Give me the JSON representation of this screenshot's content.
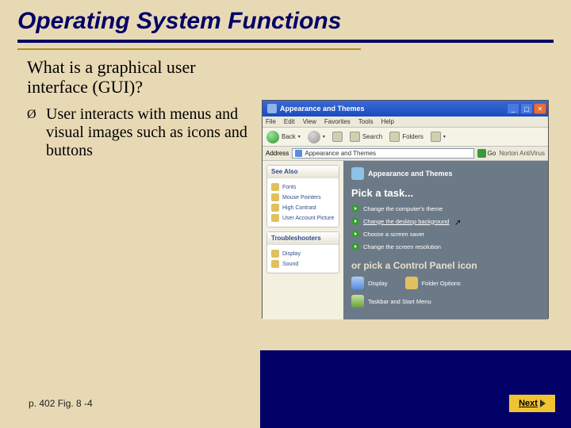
{
  "title": "Operating System Functions",
  "question": "What is a graphical user interface (GUI)?",
  "bullet_mark": "Ø",
  "bullet_text": "User interacts with menus and visual images such as icons and buttons",
  "screenshot": {
    "window_title": "Appearance and Themes",
    "menubar": [
      "File",
      "Edit",
      "View",
      "Favorites",
      "Tools",
      "Help"
    ],
    "toolbar": {
      "back": "Back",
      "search": "Search",
      "folders": "Folders"
    },
    "addrbar": {
      "label": "Address",
      "value": "Appearance and Themes",
      "go": "Go",
      "norton": "Norton AntiVirus"
    },
    "left": {
      "see_also": {
        "heading": "See Also",
        "items": [
          "Fonts",
          "Mouse Pointers",
          "High Contrast",
          "User Account Picture"
        ]
      },
      "troubleshoot": {
        "heading": "Troubleshooters",
        "items": [
          "Display",
          "Sound"
        ]
      }
    },
    "right": {
      "category": "Appearance and Themes",
      "pick_task": "Pick a task...",
      "tasks": [
        "Change the computer's theme",
        "Change the desktop background",
        "Choose a screen saver",
        "Change the screen resolution"
      ],
      "or_pick": "or pick a Control Panel icon",
      "icons": {
        "display": "Display",
        "folder": "Folder Options",
        "taskbar": "Taskbar and Start Menu"
      }
    }
  },
  "page_ref": "p. 402 Fig. 8 -4",
  "next_label": "Next"
}
